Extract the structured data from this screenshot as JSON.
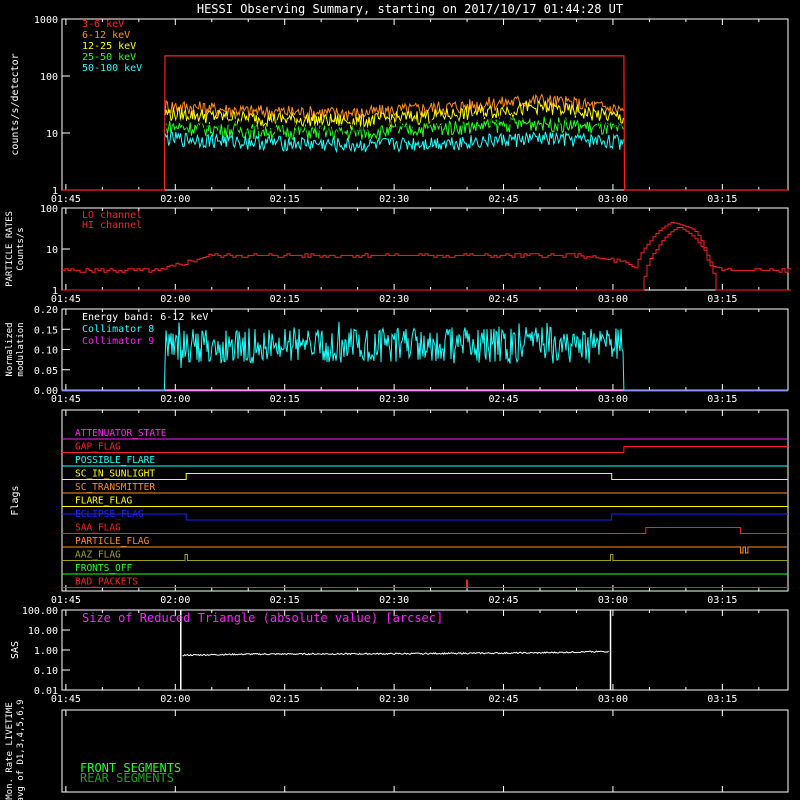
{
  "title": "HESSI Observing Summary, starting on 2017/10/17 01:44:28 UT",
  "time_ticks": [
    "01:45",
    "02:00",
    "02:15",
    "02:30",
    "02:45",
    "03:00",
    "03:15"
  ],
  "colors": {
    "bg": "#000000",
    "axis": "#ffffff",
    "band_3_6": "#ff2020",
    "band_6_12": "#ff8c1a",
    "band_12_25": "#ffff00",
    "band_25_50": "#20ff20",
    "band_50_100": "#20ffff",
    "magenta": "#ff20ff",
    "blue": "#2020ff",
    "green": "#20ff20",
    "olive": "#a0a020",
    "orange": "#ff8c1a",
    "red": "#ff2020",
    "yellow": "#ffff00",
    "cyan": "#20ffff",
    "darkgreen": "#20a020"
  },
  "chart_data": [
    {
      "id": "count_rates",
      "type": "line",
      "ylabel": "counts/s/detector",
      "yscale": "log",
      "ylim": [
        1,
        1000
      ],
      "y_ticks": [
        "1",
        "10",
        "100",
        "1000"
      ],
      "x_range": [
        "01:44:28",
        "03:24:00"
      ],
      "series": [
        {
          "name": "3-6 keV",
          "color": "#ff2020",
          "x": [
            "01:44:28",
            "01:58:30",
            "01:58:35",
            "03:01:30",
            "03:01:35",
            "03:24:00"
          ],
          "y": [
            1,
            1,
            225,
            225,
            1,
            1
          ]
        },
        {
          "name": "6-12 keV",
          "color": "#ff8c1a",
          "x": [
            "01:58:35",
            "02:10",
            "02:25",
            "02:40",
            "02:50",
            "03:01:30"
          ],
          "y": [
            30,
            24,
            22,
            30,
            38,
            25
          ]
        },
        {
          "name": "12-25 keV",
          "color": "#ffff00",
          "x": [
            "01:58:35",
            "02:10",
            "02:25",
            "02:40",
            "02:50",
            "03:01:30"
          ],
          "y": [
            22,
            18,
            16,
            22,
            28,
            18
          ]
        },
        {
          "name": "25-50 keV",
          "color": "#20ff20",
          "x": [
            "01:58:35",
            "02:10",
            "02:25",
            "02:40",
            "02:50",
            "03:01:30"
          ],
          "y": [
            13,
            11,
            10,
            13,
            15,
            11
          ]
        },
        {
          "name": "50-100 keV",
          "color": "#20ffff",
          "x": [
            "01:58:35",
            "02:10",
            "02:25",
            "02:40",
            "02:50",
            "03:01:30"
          ],
          "y": [
            8,
            7,
            6,
            7,
            8,
            7
          ]
        }
      ]
    },
    {
      "id": "particle_rates",
      "type": "line",
      "ylabel": "PARTICLE RATES Counts/s",
      "yscale": "log",
      "ylim": [
        1,
        100
      ],
      "y_ticks": [
        "1",
        "10",
        "100"
      ],
      "series": [
        {
          "name": "LO channel",
          "color": "#ff2020",
          "x": [
            "01:44:28",
            "01:58",
            "02:00",
            "02:02",
            "02:05",
            "02:20",
            "02:40",
            "02:55",
            "03:01",
            "03:03",
            "03:05",
            "03:08",
            "03:11",
            "03:13",
            "03:16",
            "03:24"
          ],
          "y": [
            3,
            3,
            4,
            5,
            7,
            7,
            7,
            7,
            5,
            3,
            15,
            45,
            30,
            4,
            3,
            3
          ]
        },
        {
          "name": "HI channel",
          "color": "#ff2020",
          "x": [
            "01:44:28",
            "03:04",
            "03:06",
            "03:09",
            "03:12",
            "03:14",
            "03:24"
          ],
          "y": [
            1,
            1,
            10,
            35,
            12,
            1,
            1
          ]
        }
      ]
    },
    {
      "id": "modulation",
      "type": "line",
      "ylabel": "Normalized modulation",
      "ylim": [
        0,
        0.2
      ],
      "y_ticks": [
        "0.00",
        "0.05",
        "0.10",
        "0.15",
        "0.20"
      ],
      "annotation": "Energy band: 6-12 keV",
      "series": [
        {
          "name": "Collimator 8",
          "color": "#20ffff",
          "x": [
            "01:44:28",
            "01:58:30",
            "01:58:35",
            "03:01:30",
            "03:01:35",
            "03:24:00"
          ],
          "y": [
            0,
            0,
            0.11,
            0.11,
            0,
            0
          ]
        },
        {
          "name": "Collimator 9",
          "color": "#ff20ff",
          "x": [
            "01:44:28",
            "03:24:00"
          ],
          "y": [
            0,
            0
          ]
        }
      ]
    },
    {
      "id": "flags",
      "type": "line",
      "ylabel": "Flags",
      "series": [
        {
          "name": "ATTENUATOR_STATE",
          "color": "#ff20ff"
        },
        {
          "name": "GAP_FLAG",
          "color": "#ff2020"
        },
        {
          "name": "POSSIBLE_FLARE",
          "color": "#20ffff"
        },
        {
          "name": "SC_IN_SUNLIGHT",
          "color": "#ffff00"
        },
        {
          "name": "SC_TRANSMITTER",
          "color": "#ff8c1a"
        },
        {
          "name": "FLARE_FLAG",
          "color": "#ffff00"
        },
        {
          "name": "ECLIPSE_FLAG",
          "color": "#2020ff"
        },
        {
          "name": "SAA_FLAG",
          "color": "#ff2020"
        },
        {
          "name": "PARTICLE_FLAG",
          "color": "#ff8c1a"
        },
        {
          "name": "AAZ_FLAG",
          "color": "#a0a020"
        },
        {
          "name": "FRONTS_OFF",
          "color": "#20ff20"
        },
        {
          "name": "BAD_PACKETS",
          "color": "#ff2020"
        }
      ]
    },
    {
      "id": "sas",
      "type": "line",
      "ylabel": "SAS",
      "yscale": "log",
      "ylim": [
        0.01,
        100
      ],
      "y_ticks": [
        "0.01",
        "0.10",
        "1.00",
        "10.00",
        "100.00"
      ],
      "annotation": "Size of Reduced Triangle (absolute value) [arcsec]",
      "series": [
        {
          "name": "",
          "color": "#ffffff",
          "x": [
            "02:00:30",
            "02:01",
            "02:10",
            "02:30",
            "02:50",
            "02:59:30"
          ],
          "y": [
            1.0,
            0.55,
            0.62,
            0.65,
            0.72,
            0.85
          ]
        }
      ]
    },
    {
      "id": "livetime",
      "type": "line",
      "ylabel": "Mon. Rate LIVETIME avg of D1,3,4,5,6,9",
      "series": [
        {
          "name": "FRONT SEGMENTS",
          "color": "#20ff20"
        },
        {
          "name": "REAR SEGMENTS",
          "color": "#20a020"
        }
      ]
    }
  ]
}
